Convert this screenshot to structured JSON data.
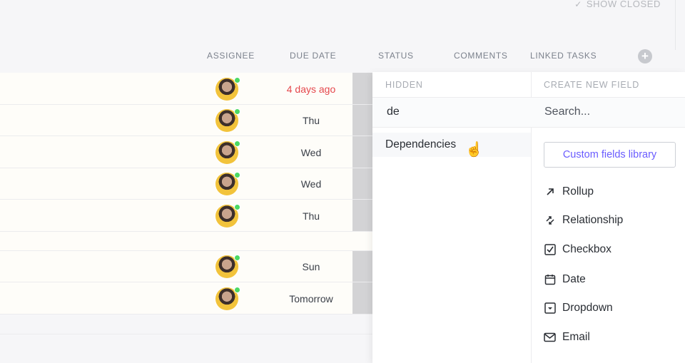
{
  "toolbar": {
    "show_closed_label": "SHOW CLOSED",
    "show_closed_icon": "check-icon"
  },
  "columns": [
    "ASSIGNEE",
    "DUE DATE",
    "STATUS",
    "COMMENTS",
    "LINKED TASKS"
  ],
  "tasks": [
    {
      "due": "4 days ago",
      "overdue": true
    },
    {
      "due": "Thu"
    },
    {
      "due": "Wed"
    },
    {
      "due": "Wed"
    },
    {
      "due": "Thu"
    },
    {
      "due": "Sun"
    },
    {
      "due": "Tomorrow"
    }
  ],
  "panel": {
    "hidden_label": "HIDDEN",
    "hidden_filter": "de",
    "hidden_results": [
      "Dependencies"
    ],
    "create_label": "CREATE NEW FIELD",
    "search_placeholder": "Search...",
    "library_button": "Custom fields library",
    "field_types": [
      {
        "label": "Rollup",
        "icon": "arrow-up-right-icon"
      },
      {
        "label": "Relationship",
        "icon": "relationship-icon"
      },
      {
        "label": "Checkbox",
        "icon": "checkbox-icon"
      },
      {
        "label": "Date",
        "icon": "calendar-icon"
      },
      {
        "label": "Dropdown",
        "icon": "dropdown-icon"
      },
      {
        "label": "Email",
        "icon": "mail-icon"
      }
    ]
  },
  "colors": {
    "overdue": "#e5484d",
    "accent": "#6a5cff",
    "online": "#4cd964"
  }
}
